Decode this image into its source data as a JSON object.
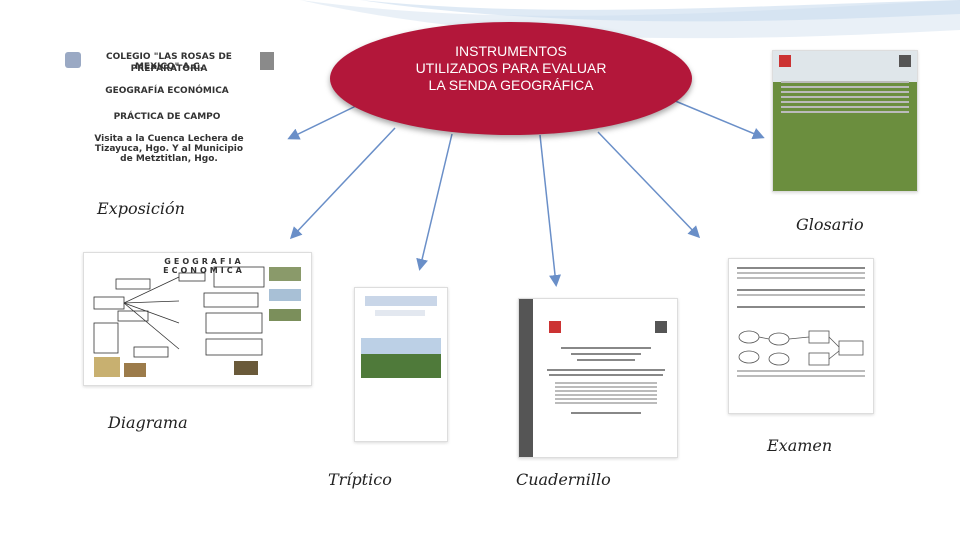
{
  "center": {
    "title": "INSTRUMENTOS\nUTILIZADOS PARA EVALUAR\nLA SENDA GEOGRÁFICA",
    "color": "#b3173a"
  },
  "items": [
    {
      "key": "exposicion",
      "label": "Exposición"
    },
    {
      "key": "glosario",
      "label": "Glosario"
    },
    {
      "key": "diagrama",
      "label": "Diagrama"
    },
    {
      "key": "triptico",
      "label": "Tríptico"
    },
    {
      "key": "cuadernillo",
      "label": "Cuadernillo"
    },
    {
      "key": "examen",
      "label": "Examen"
    }
  ],
  "exposicion_doc": {
    "line1": "COLEGIO \"LAS ROSAS DE MEXICO\" A.C.",
    "line2": "PREPARATORIA",
    "line3": "GEOGRAFÍA ECONÓMICA",
    "line4": "PRÁCTICA DE CAMPO",
    "line5": "Visita a la Cuenca Lechera de Tizayuca, Hgo. Y al Municipio de Metztitlan, Hgo."
  },
  "diagrama_doc": {
    "title": "GEOGRAFIA ECONOMICA"
  }
}
